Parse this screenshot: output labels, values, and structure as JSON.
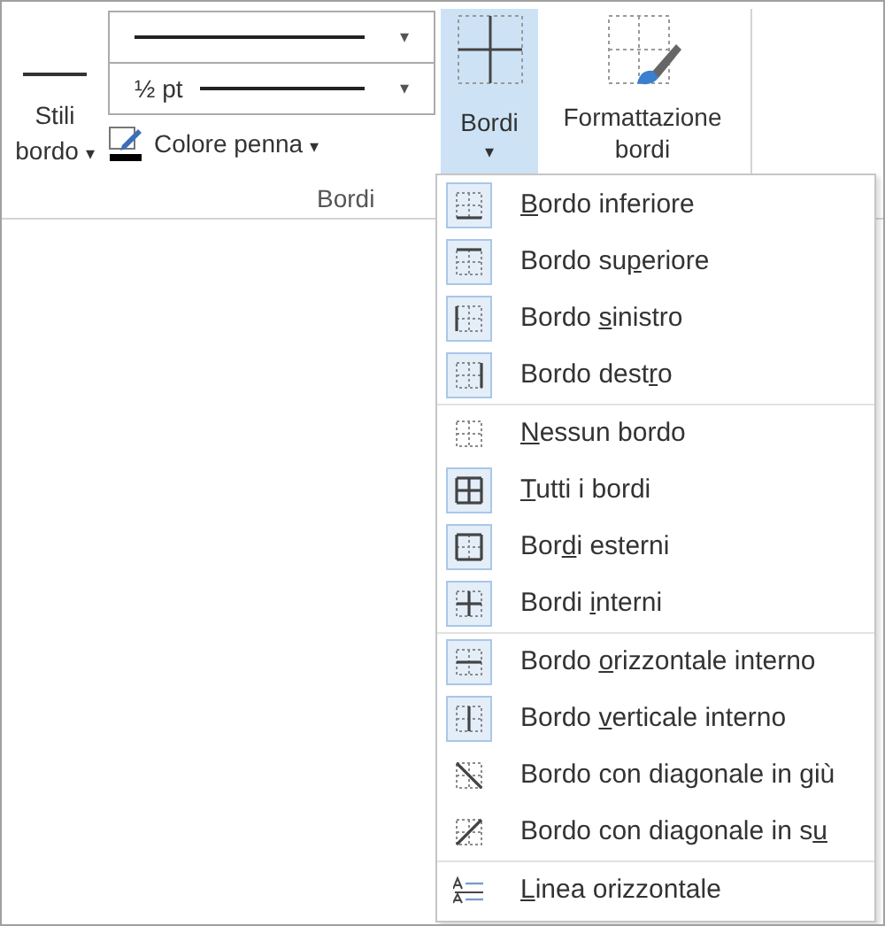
{
  "ribbon": {
    "border_styles": {
      "label_line1": "Stili",
      "label_line2": "bordo",
      "caret": "▾"
    },
    "line_style": {
      "caret": "▾"
    },
    "line_weight": {
      "value": "½ pt",
      "caret": "▾"
    },
    "pen_color": {
      "label": "Colore penna",
      "caret": "▾",
      "color": "#000000"
    },
    "borders_button": {
      "label": "Bordi",
      "caret": "▾",
      "selected": true
    },
    "border_painter": {
      "label_line1": "Formattazione",
      "label_line2": "bordi"
    },
    "group_label": "Bordi"
  },
  "menu": {
    "groups": [
      [
        {
          "kind": "bottom",
          "highlighted": true,
          "key": "B",
          "after": "ordo inferiore"
        },
        {
          "kind": "top",
          "highlighted": true,
          "before": "Bordo su",
          "key": "p",
          "after": "eriore"
        },
        {
          "kind": "left",
          "highlighted": true,
          "before": "Bordo ",
          "key": "s",
          "after": "inistro"
        },
        {
          "kind": "right",
          "highlighted": true,
          "before": "Bordo dest",
          "key": "r",
          "after": "o"
        }
      ],
      [
        {
          "kind": "none",
          "highlighted": false,
          "key": "N",
          "after": "essun bordo"
        },
        {
          "kind": "all",
          "highlighted": true,
          "key": "T",
          "after": "utti i bordi"
        },
        {
          "kind": "outside",
          "highlighted": true,
          "before": "Bor",
          "key": "d",
          "after": "i esterni"
        },
        {
          "kind": "inside",
          "highlighted": true,
          "before": "Bordi ",
          "key": "i",
          "after": "nterni"
        }
      ],
      [
        {
          "kind": "inside_h",
          "highlighted": true,
          "before": "Bordo ",
          "key": "o",
          "after": "rizzontale interno"
        },
        {
          "kind": "inside_v",
          "highlighted": true,
          "before": "Bordo ",
          "key": "v",
          "after": "erticale interno"
        },
        {
          "kind": "diag_down",
          "highlighted": false,
          "before": "Bordo con diagonale in giù"
        },
        {
          "kind": "diag_up",
          "highlighted": false,
          "before": "Bordo con diagonale in s",
          "key": "u"
        }
      ],
      [
        {
          "kind": "hline",
          "highlighted": false,
          "key": "L",
          "after": "inea orizzontale"
        }
      ]
    ]
  }
}
